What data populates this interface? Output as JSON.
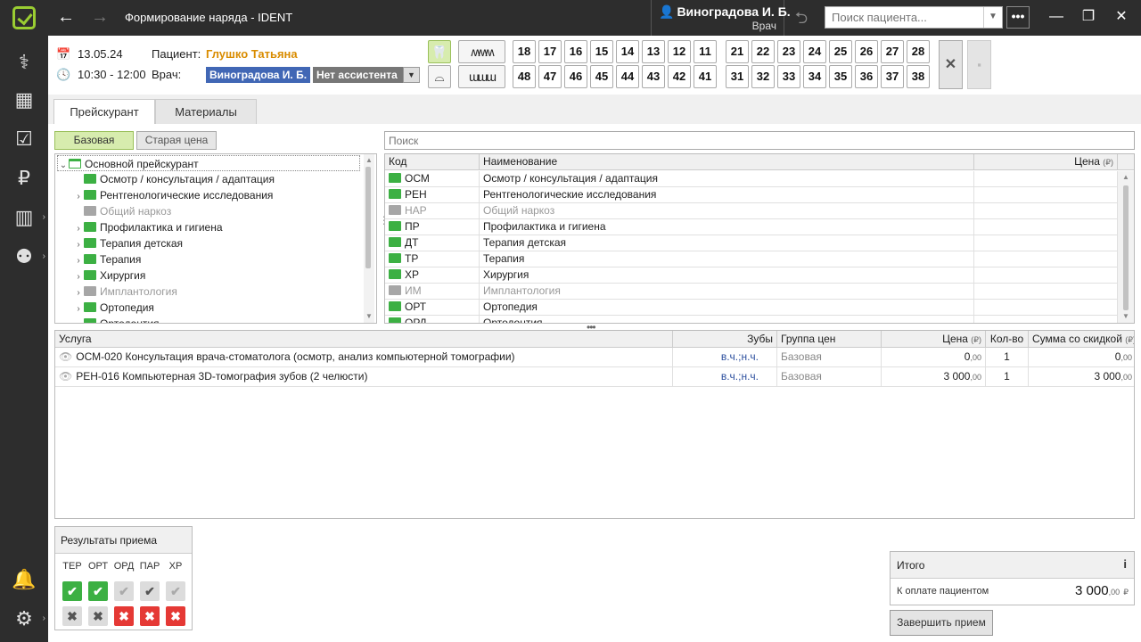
{
  "window": {
    "title": "Формирование наряда - IDENT",
    "back": "←",
    "forward": "→",
    "minimize": "—",
    "restore": "❐",
    "close": "✕"
  },
  "user": {
    "name": "Виноградова И. Б.",
    "role": "Врач"
  },
  "patient_search": {
    "placeholder": "Поиск пациента..."
  },
  "menu_label": "•••",
  "visit": {
    "date": "13.05.24",
    "time": "10:30 - 12:00",
    "patient_label": "Пациент:",
    "patient_name": "Глушко Татьяна",
    "doctor_label": "Врач:",
    "doctor_name": "Виноградова И. Б.",
    "assistant": "Нет ассистента"
  },
  "teeth": {
    "upper_right": [
      "18",
      "17",
      "16",
      "15",
      "14",
      "13",
      "12",
      "11"
    ],
    "upper_left": [
      "21",
      "22",
      "23",
      "24",
      "25",
      "26",
      "27",
      "28"
    ],
    "lower_right": [
      "48",
      "47",
      "46",
      "45",
      "44",
      "43",
      "42",
      "41"
    ],
    "lower_left": [
      "31",
      "32",
      "33",
      "34",
      "35",
      "36",
      "37",
      "38"
    ]
  },
  "tabs": [
    {
      "label": "Прейскурант"
    },
    {
      "label": "Материалы"
    }
  ],
  "price_toggle": {
    "base": "Базовая",
    "old": "Старая цена"
  },
  "search": {
    "placeholder": "Поиск"
  },
  "tree": {
    "root": "Основной прейскурант",
    "items": [
      {
        "label": "Осмотр / консультация / адаптация",
        "expandable": false,
        "disabled": false
      },
      {
        "label": "Рентгенологические исследования",
        "expandable": true,
        "disabled": false
      },
      {
        "label": "Общий наркоз",
        "expandable": false,
        "disabled": true
      },
      {
        "label": "Профилактика и гигиена",
        "expandable": true,
        "disabled": false
      },
      {
        "label": "Терапия детская",
        "expandable": true,
        "disabled": false
      },
      {
        "label": "Терапия",
        "expandable": true,
        "disabled": false
      },
      {
        "label": "Хирургия",
        "expandable": true,
        "disabled": false
      },
      {
        "label": "Имплантология",
        "expandable": true,
        "disabled": true
      },
      {
        "label": "Ортопедия",
        "expandable": true,
        "disabled": false
      },
      {
        "label": "Ортодонтия",
        "expandable": true,
        "disabled": false
      }
    ]
  },
  "price_grid": {
    "headers": {
      "code": "Код",
      "name": "Наименование",
      "price": "Цена",
      "currency": "(₽)"
    },
    "rows": [
      {
        "code": "ОСМ",
        "name": "Осмотр / консультация / адаптация",
        "disabled": false
      },
      {
        "code": "РЕН",
        "name": "Рентгенологические исследования",
        "disabled": false
      },
      {
        "code": "НАР",
        "name": "Общий наркоз",
        "disabled": true
      },
      {
        "code": "ПР",
        "name": "Профилактика и гигиена",
        "disabled": false
      },
      {
        "code": "ДТ",
        "name": "Терапия детская",
        "disabled": false
      },
      {
        "code": "ТР",
        "name": "Терапия",
        "disabled": false
      },
      {
        "code": "ХР",
        "name": "Хирургия",
        "disabled": false
      },
      {
        "code": "ИМ",
        "name": "Имплантология",
        "disabled": true
      },
      {
        "code": "ОРТ",
        "name": "Ортопедия",
        "disabled": false
      },
      {
        "code": "ОРД",
        "name": "Ортодонтия",
        "disabled": false
      }
    ]
  },
  "services": {
    "headers": {
      "service": "Услуга",
      "teeth": "Зубы",
      "group": "Группа цен",
      "price": "Цена",
      "qty": "Кол-во",
      "sum": "Сумма со скидкой",
      "currency": "(₽)"
    },
    "rows": [
      {
        "code": "ОСМ-020",
        "name": "Консультация врача-стоматолога (осмотр, анализ компьютерной томографии)",
        "teeth": "в.ч.;н.ч.",
        "group": "Базовая",
        "price_int": "0",
        "price_dec": ",00",
        "qty": "1",
        "sum_int": "0",
        "sum_dec": ",00"
      },
      {
        "code": "РЕН-016",
        "name": "Компьютерная 3D-томография зубов (2 челюсти)",
        "teeth": "в.ч.;н.ч.",
        "group": "Базовая",
        "price_int": "3 000",
        "price_dec": ",00",
        "qty": "1",
        "sum_int": "3 000",
        "sum_dec": ",00"
      }
    ]
  },
  "results": {
    "title": "Результаты приема",
    "columns": [
      "ТЕР",
      "ОРТ",
      "ОРД",
      "ПАР",
      "ХР"
    ]
  },
  "totals": {
    "title": "Итого",
    "info": "i",
    "label": "К оплате пациентом",
    "value_int": "3 000",
    "value_dec": ",00",
    "currency": "₽"
  },
  "finish_button": "Завершить прием",
  "colors": {
    "accent": "#9acd32",
    "folder": "#3cb043",
    "doctor_bg": "#4167b5",
    "patient_name": "#d98c00",
    "danger": "#e53935"
  }
}
